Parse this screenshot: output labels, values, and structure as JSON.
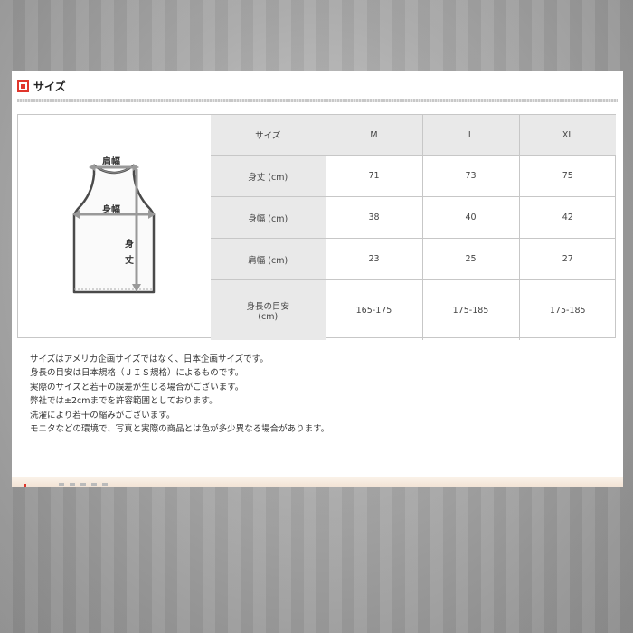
{
  "section": {
    "title": "サイズ",
    "icon": "square-bullet-icon",
    "accent_color": "#e0362c"
  },
  "illustration": {
    "icon": "tank-top-diagram-icon",
    "labels": {
      "shoulder_width": "肩幅",
      "body_width": "身幅",
      "body_length": "身丈"
    }
  },
  "size_table": {
    "header": [
      "サイズ",
      "M",
      "L",
      "XL"
    ],
    "rows": [
      {
        "label": "身丈 (cm)",
        "values": [
          "71",
          "73",
          "75"
        ]
      },
      {
        "label": "身幅 (cm)",
        "values": [
          "38",
          "40",
          "42"
        ]
      },
      {
        "label": "肩幅 (cm)",
        "values": [
          "23",
          "25",
          "27"
        ]
      },
      {
        "label": "身長の目安",
        "label2": "(cm)",
        "values": [
          "165-175",
          "175-185",
          "175-185"
        ]
      }
    ]
  },
  "notes": [
    "サイズはアメリカ企画サイズではなく、日本企画サイズです。",
    "身長の目安は日本規格（ＪＩＳ規格）によるものです。",
    "実際のサイズと若干の誤差が生じる場合がございます。",
    "弊社では±2cmまでを許容範囲としております。",
    "洗濯により若干の縮みがございます。",
    "モニタなどの環境で、写真と実際の商品とは色が多少異なる場合があります。"
  ]
}
